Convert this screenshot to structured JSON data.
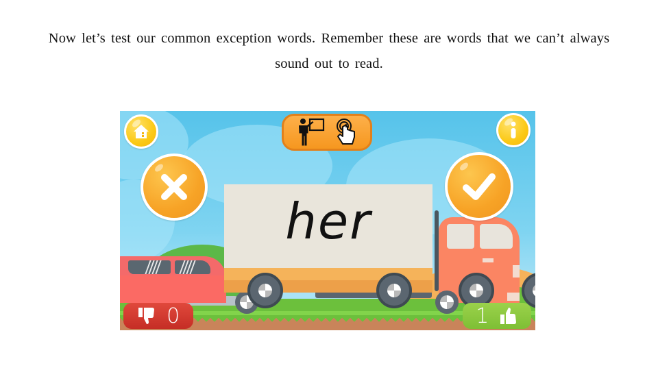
{
  "caption": {
    "line1": "Now let’s test our common exception words. Remember these are words that we can’t always",
    "line2": "sound out to read."
  },
  "game": {
    "current_word": "her",
    "buttons": {
      "home": {
        "icon": "home-icon"
      },
      "info": {
        "icon": "info-icon",
        "glyph": "i"
      },
      "wrong": {
        "icon": "cross-icon",
        "glyph": "✖"
      },
      "correct": {
        "icon": "check-icon",
        "glyph": "✔"
      },
      "mode_toggle": {
        "icons": [
          "teacher-icon",
          "touch-icon"
        ]
      }
    },
    "scores": {
      "wrong_count": "0",
      "correct_count": "1"
    },
    "colors": {
      "sky": "#56c3ea",
      "button_orange": "#f7a326",
      "button_yellow": "#fbc916",
      "wrong_red": "#c52d25",
      "correct_green": "#7ebf35",
      "truck_cab": "#fb8563",
      "car_red": "#fb6a64"
    }
  }
}
